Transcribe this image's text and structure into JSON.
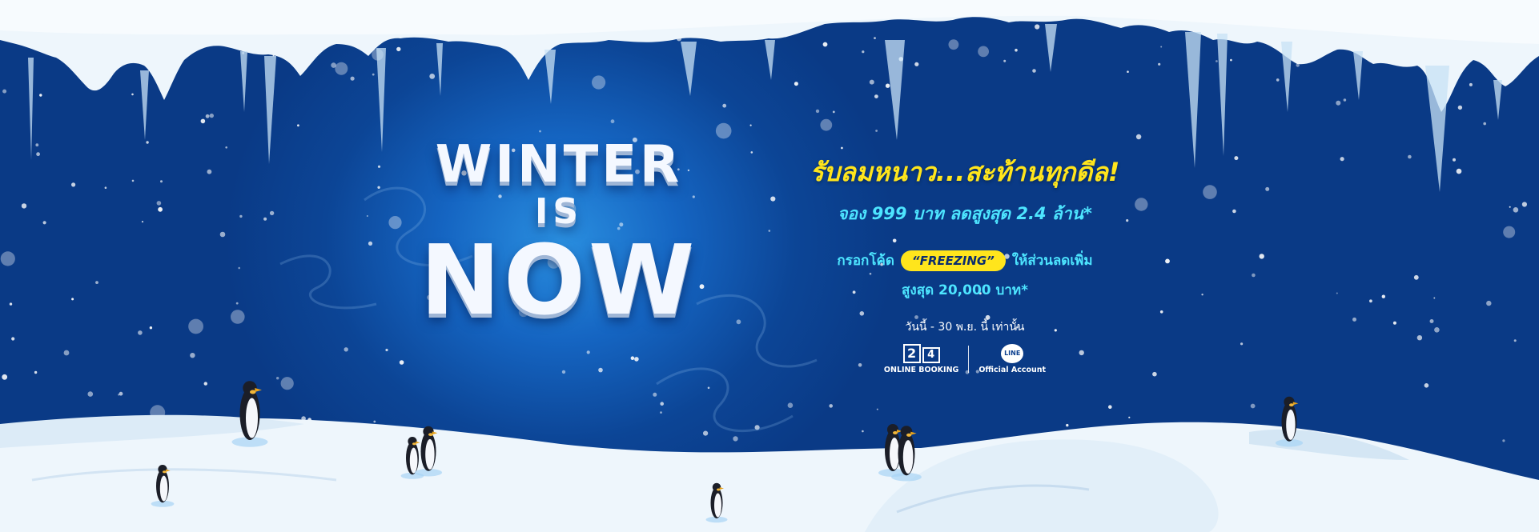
{
  "headline": {
    "line1": "WINTER",
    "line2": "IS",
    "line3": "NOW"
  },
  "promo": {
    "tagline": "รับลมหนาว...สะท้านทุกดีล!",
    "subline": "จอง 999 บาท ลดสูงสุด 2.4 ล้าน*",
    "code_prefix": "กรอกโค้ด",
    "code": "“FREEZING”",
    "code_suffix": "ให้ส่วนลดเพิ่ม",
    "code_line2": "สูงสุด 20,000 บาท*",
    "period": "วันนี้ - 30 พ.ย. นี้ เท่านั้น"
  },
  "logos": {
    "online_digit_1": "2",
    "online_digit_2": "4",
    "online_caption": "ONLINE BOOKING",
    "line_mark": "LINE",
    "line_caption": "Official Account"
  },
  "icons": [
    "online-booking-24-logo-icon",
    "line-logo-icon",
    "penguin-icon",
    "icicle-icon",
    "snowflake-icon"
  ],
  "colors": {
    "background": "#0a3a86",
    "glow": "#2a8fe0",
    "tagline": "#ffe51c",
    "accent_text": "#4de5ff",
    "code_badge": "#ffe51c",
    "snow": "#eef6fc"
  }
}
